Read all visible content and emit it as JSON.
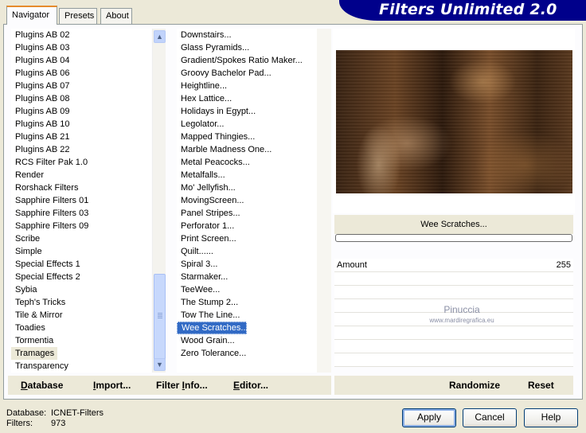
{
  "app": {
    "title": "Filters Unlimited 2.0"
  },
  "tabs": [
    {
      "label": "Navigator",
      "active": true
    },
    {
      "label": "Presets",
      "active": false
    },
    {
      "label": "About",
      "active": false
    }
  ],
  "categories": {
    "items": [
      "Plugins AB 02",
      "Plugins AB 03",
      "Plugins AB 04",
      "Plugins AB 06",
      "Plugins AB 07",
      "Plugins AB 08",
      "Plugins AB 09",
      "Plugins AB 10",
      "Plugins AB 21",
      "Plugins AB 22",
      "RCS Filter Pak 1.0",
      "Render",
      "Rorshack Filters",
      "Sapphire Filters 01",
      "Sapphire Filters 03",
      "Sapphire Filters 09",
      "Scribe",
      "Simple",
      "Special Effects 1",
      "Special Effects 2",
      "Sybia",
      "Teph's Tricks",
      "Tile & Mirror",
      "Toadies",
      "Tormentia",
      "Tramages",
      "Transparency"
    ],
    "selected": "Tramages"
  },
  "filters": {
    "items": [
      "Downstairs...",
      "Glass Pyramids...",
      "Gradient/Spokes Ratio Maker...",
      "Groovy Bachelor Pad...",
      "Heightline...",
      "Hex Lattice...",
      "Holidays in Egypt...",
      "Legolator...",
      "Mapped Thingies...",
      "Marble Madness One...",
      "Metal Peacocks...",
      "Metalfalls...",
      "Mo' Jellyfish...",
      "MovingScreen...",
      "Panel Stripes...",
      "Perforator 1...",
      "Print Screen...",
      "Quilt......",
      "Spiral 3...",
      "Starmaker...",
      "TeeWee...",
      "The Stump 2...",
      "Tow The Line...",
      "Wee Scratches...",
      "Wood Grain...",
      "Zero Tolerance..."
    ],
    "selected": "Wee Scratches..."
  },
  "preview": {
    "filter_name": "Wee Scratches...",
    "progress": 0
  },
  "parameters": [
    {
      "label": "Amount",
      "value": "255"
    }
  ],
  "watermark": {
    "line1": "Pinuccia",
    "line2": "www.mardiregrafica.eu"
  },
  "toolbar": {
    "database": {
      "u": "D",
      "rest": "atabase"
    },
    "import": {
      "u": "I",
      "rest": "mport..."
    },
    "filter_info": {
      "pre": "Filter ",
      "u": "I",
      "rest": "nfo..."
    },
    "editor": {
      "u": "E",
      "rest": "ditor..."
    },
    "randomize": "Randomize",
    "reset": "Reset"
  },
  "status": {
    "database_label": "Database:",
    "database_value": "ICNET-Filters",
    "filters_label": "Filters:",
    "filters_value": "973"
  },
  "buttons": {
    "apply": "Apply",
    "cancel": "Cancel",
    "help": "Help"
  },
  "colors": {
    "banner_bg": "#00008b",
    "selection": "#316ac5",
    "dialog_bg": "#ece9d8"
  }
}
